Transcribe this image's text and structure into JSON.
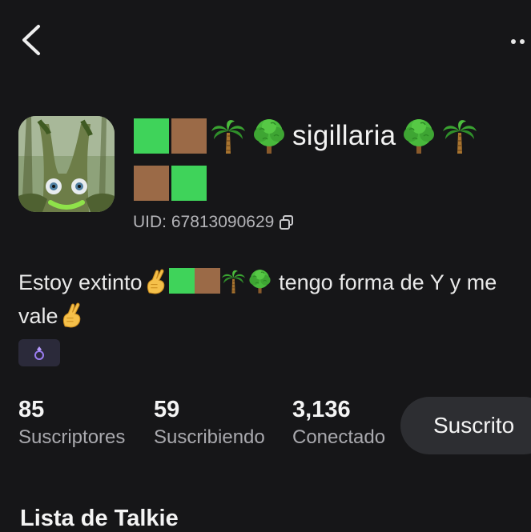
{
  "header": {
    "back_icon": "chevron-left-icon",
    "more_icon": "more-dots-icon"
  },
  "profile": {
    "avatar_icon": "tree-creature-avatar",
    "name_text": "sigillaria",
    "name_emojis": [
      "green-square",
      "brown-square",
      "palm-tree",
      "deciduous-tree",
      "deciduous-tree",
      "palm-tree",
      "brown-square",
      "green-square"
    ],
    "uid": "UID: 67813090629",
    "bio_part1": "Estoy extinto",
    "bio_part2": " tengo forma de Y y me",
    "bio_part3": "vale",
    "badge_icon": "ring-badge-icon"
  },
  "stats": [
    {
      "value": "85",
      "label": "Suscriptores"
    },
    {
      "value": "59",
      "label": "Suscribiendo"
    },
    {
      "value": "3,136",
      "label": "Conectado"
    }
  ],
  "subscribe_button": "Suscrito",
  "section_title": "Lista de Talkie",
  "colors": {
    "background": "#161618",
    "green": "#3fd35a",
    "brown": "#9b6a47",
    "button": "#2d2e32"
  }
}
